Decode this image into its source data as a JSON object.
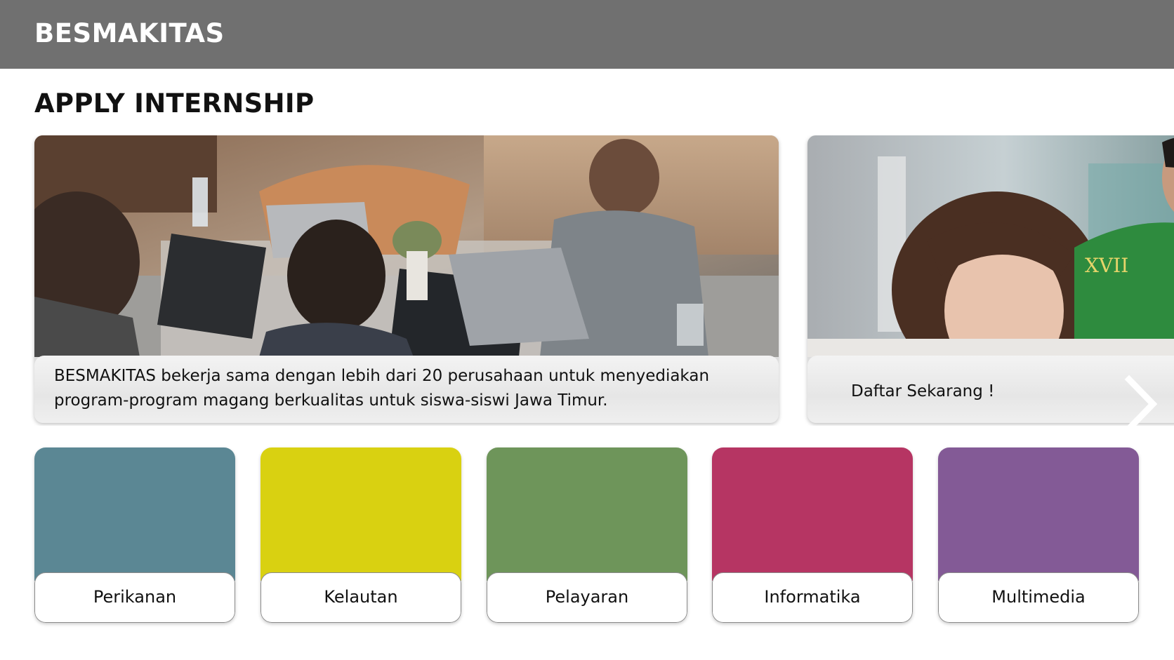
{
  "header": {
    "brand": "BESMAKITAS",
    "background_color": "#707070"
  },
  "page": {
    "title": "APPLY INTERNSHIP"
  },
  "carousel": {
    "slides": [
      {
        "image": "students-working-on-laptops-photo",
        "caption": "BESMAKITAS bekerja sama dengan lebih dari 20 perusahaan untuk menyediakan program-program magang berkualitas untuk siswa-siswi Jawa Timur."
      },
      {
        "image": "student-studying-photo",
        "caption": "Daftar Sekarang !"
      }
    ],
    "next_icon": "chevron-right-icon"
  },
  "categories": [
    {
      "label": "Perikanan",
      "color": "#5b8794"
    },
    {
      "label": "Kelautan",
      "color": "#d9d111"
    },
    {
      "label": "Pelayaran",
      "color": "#6e955a"
    },
    {
      "label": "Informatika",
      "color": "#b63563"
    },
    {
      "label": "Multimedia",
      "color": "#835a96"
    }
  ]
}
